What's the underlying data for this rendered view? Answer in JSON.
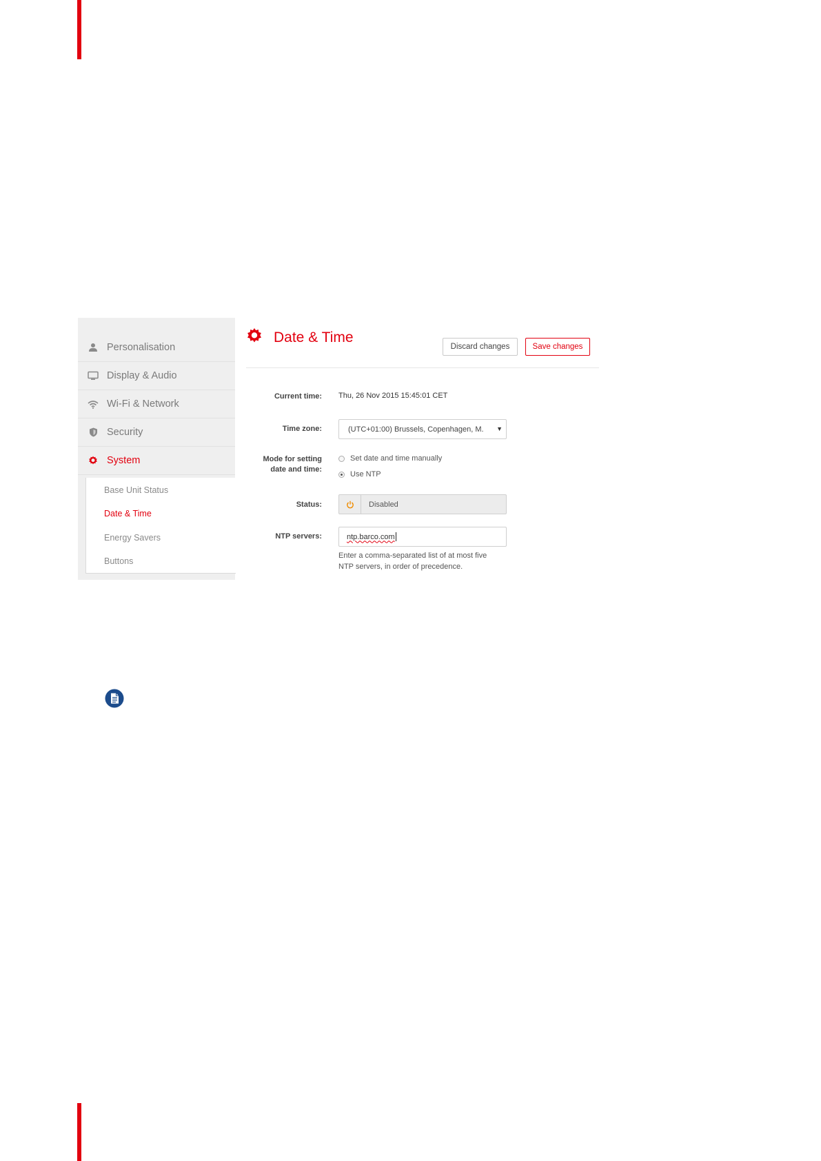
{
  "sidebar": {
    "items": [
      {
        "label": "Personalisation",
        "icon": "user-icon"
      },
      {
        "label": "Display & Audio",
        "icon": "monitor-icon"
      },
      {
        "label": "Wi-Fi & Network",
        "icon": "wifi-icon"
      },
      {
        "label": "Security",
        "icon": "shield-icon"
      },
      {
        "label": "System",
        "icon": "gear-icon",
        "active": true
      }
    ],
    "subitems": [
      {
        "label": "Base Unit Status"
      },
      {
        "label": "Date & Time",
        "active": true
      },
      {
        "label": "Energy Savers"
      },
      {
        "label": "Buttons"
      }
    ]
  },
  "header": {
    "title": "Date & Time",
    "discard_label": "Discard changes",
    "save_label": "Save changes"
  },
  "form": {
    "current_time_label": "Current time:",
    "current_time_value": "Thu, 26 Nov 2015 15:45:01 CET",
    "timezone_label": "Time zone:",
    "timezone_value": "(UTC+01:00) Brussels, Copenhagen, M.",
    "mode_label_1": "Mode for setting",
    "mode_label_2": "date and time:",
    "mode_options": [
      {
        "label": "Set date and time manually",
        "checked": false
      },
      {
        "label": "Use NTP",
        "checked": true
      }
    ],
    "status_label": "Status:",
    "status_value": "Disabled",
    "ntp_label": "NTP servers:",
    "ntp_value": "ntp.barco.com",
    "help_line_1": "Enter a comma-separated list of at most five",
    "help_line_2": "NTP servers, in order of precedence."
  },
  "colors": {
    "accent": "#e2000f",
    "status_icon": "#f08c00",
    "note_icon": "#1c4c8c"
  }
}
